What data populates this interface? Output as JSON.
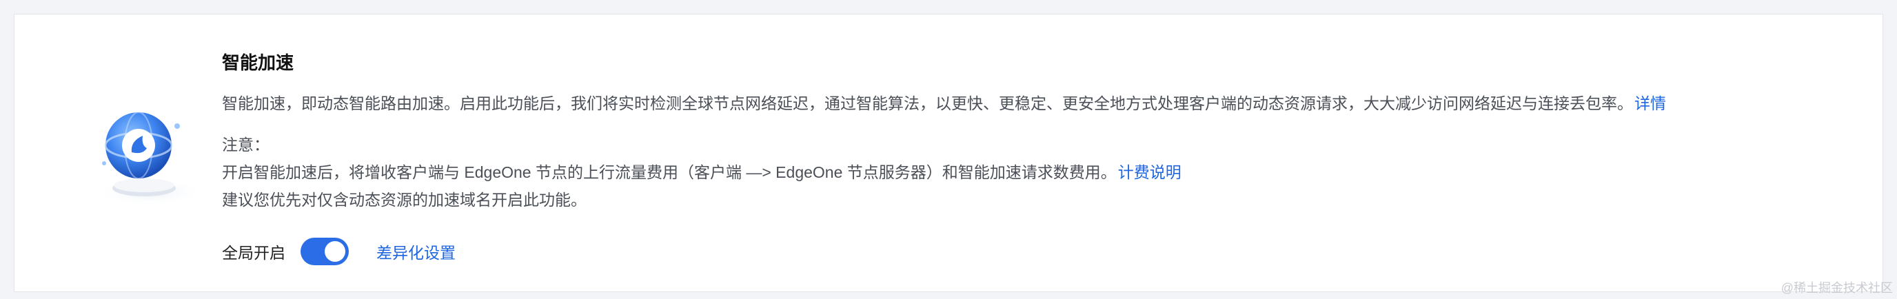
{
  "section": {
    "title": "智能加速",
    "description": "智能加速，即动态智能路由加速。启用此功能后，我们将实时检测全球节点网络延迟，通过智能算法，以更快、更稳定、更安全地方式处理客户端的动态资源请求，大大减少访问网络延迟与连接丢包率。",
    "details_link": "详情",
    "note_title": "注意：",
    "note_line1": "开启智能加速后，将增收客户端与 EdgeOne 节点的上行流量费用（客户端 —> EdgeOne 节点服务器）和智能加速请求数费用。",
    "billing_link": "计费说明",
    "note_line2": "建议您优先对仅含动态资源的加速域名开启此功能。"
  },
  "toggle": {
    "label": "全局开启",
    "state": true,
    "diff_settings_link": "差异化设置"
  },
  "watermark": "@稀土掘金技术社区",
  "colors": {
    "accent": "#2b6de6",
    "link": "#1f66e0"
  },
  "icons": {
    "illustration": "globe-acceleration-icon"
  }
}
